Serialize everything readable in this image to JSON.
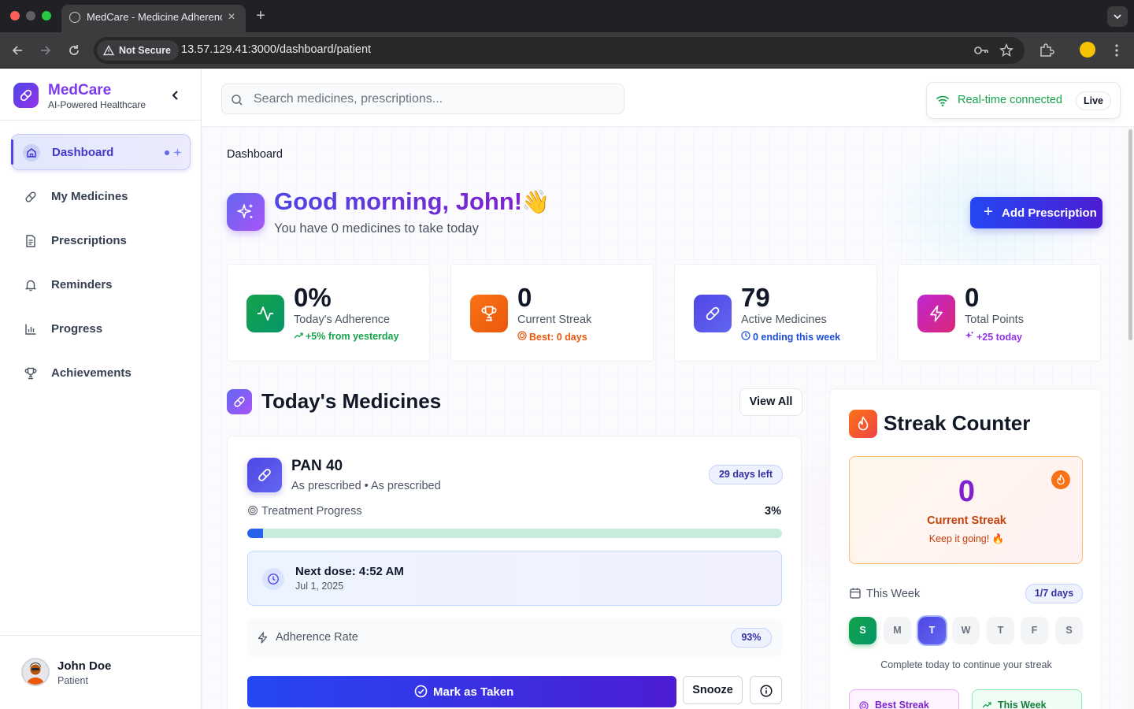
{
  "browser": {
    "tab_title": "MedCare - Medicine Adherence",
    "security_label": "Not Secure",
    "url": "13.57.129.41:3000/dashboard/patient"
  },
  "sidebar": {
    "brand_name": "MedCare",
    "brand_tagline": "AI-Powered Healthcare",
    "items": [
      {
        "label": "Dashboard",
        "icon": "home-icon",
        "active": true
      },
      {
        "label": "My Medicines",
        "icon": "pill-icon"
      },
      {
        "label": "Prescriptions",
        "icon": "document-icon"
      },
      {
        "label": "Reminders",
        "icon": "bell-icon"
      },
      {
        "label": "Progress",
        "icon": "bar-chart-icon"
      },
      {
        "label": "Achievements",
        "icon": "trophy-icon"
      }
    ],
    "user": {
      "name": "John Doe",
      "role": "Patient"
    }
  },
  "header": {
    "search_placeholder": "Search medicines, prescriptions...",
    "connection_status": "Real-time connected",
    "live_label": "Live",
    "status_color": "#16a34a"
  },
  "page": {
    "breadcrumb": "Dashboard",
    "greeting": "Good morning, John!",
    "greeting_emoji": "👋",
    "subtitle": "You have 0 medicines to take today",
    "add_button": "Add Prescription"
  },
  "stats": [
    {
      "value": "0%",
      "label": "Today's Adherence",
      "trend": "+5% from yesterday",
      "trend_color": "#16a34a",
      "icon": "activity-icon",
      "color": "#16a34a"
    },
    {
      "value": "0",
      "label": "Current Streak",
      "trend": "Best: 0 days",
      "trend_color": "#ea580c",
      "icon": "trophy-icon",
      "color": "#f97316"
    },
    {
      "value": "79",
      "label": "Active Medicines",
      "trend": "0 ending this week",
      "trend_color": "#1d4ed8",
      "icon": "pill-icon",
      "color": "#4f46e5"
    },
    {
      "value": "0",
      "label": "Total Points",
      "trend": "+25 today",
      "trend_color": "#9333ea",
      "icon": "lightning-icon",
      "color": "#c026d3"
    }
  ],
  "medicines_section": {
    "title": "Today's Medicines",
    "view_all": "View All",
    "card": {
      "name": "PAN 40",
      "dosage": "As prescribed • As prescribed",
      "days_left": "29 days left",
      "progress_label": "Treatment Progress",
      "progress_text": "3%",
      "progress_fraction": 0.03,
      "next_dose": "Next dose: 4:52 AM",
      "next_dose_date": "Jul 1, 2025",
      "adherence_label": "Adherence Rate",
      "adherence_value": "93%",
      "mark_button": "Mark as Taken",
      "snooze_button": "Snooze"
    }
  },
  "streak": {
    "title": "Streak Counter",
    "value": "0",
    "label": "Current Streak",
    "subtext": "Keep it going! 🔥",
    "week_label": "This Week",
    "week_badge": "1/7 days",
    "days": [
      {
        "letter": "S",
        "state": "done"
      },
      {
        "letter": "M",
        "state": "none"
      },
      {
        "letter": "T",
        "state": "today"
      },
      {
        "letter": "W",
        "state": "none"
      },
      {
        "letter": "T",
        "state": "none"
      },
      {
        "letter": "F",
        "state": "none"
      },
      {
        "letter": "S",
        "state": "none"
      }
    ],
    "hint": "Complete today to continue your streak",
    "best_label": "Best Streak",
    "this_week_label": "This Week"
  }
}
